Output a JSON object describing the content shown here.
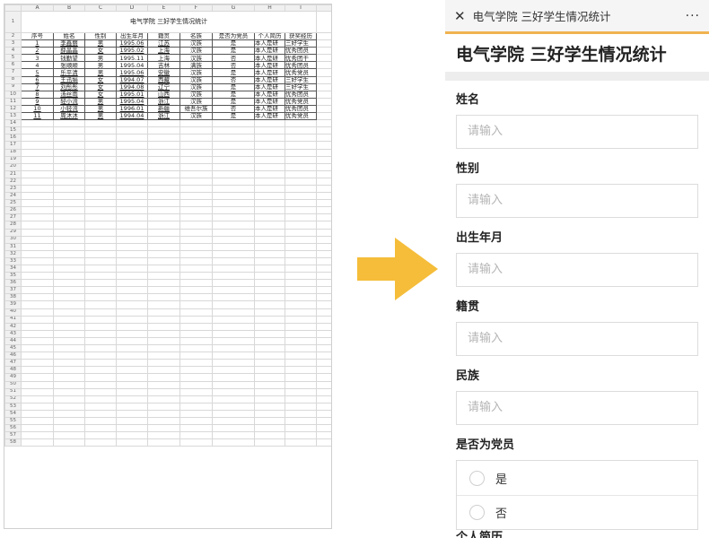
{
  "spreadsheet": {
    "col_headers": [
      "A",
      "B",
      "C",
      "D",
      "E",
      "F",
      "G",
      "H",
      "I"
    ],
    "title": "电气学院 三好学生情况统计",
    "header_row": [
      "序号",
      "姓名",
      "性别",
      "出生年月",
      "籍贯",
      "名族",
      "是否为党员",
      "个人简历",
      "获奖经历"
    ],
    "rows": [
      [
        "1",
        "李鑫丽",
        "男",
        "1995.06",
        "江苏",
        "汉族",
        "是",
        "本人是研",
        "三好学生"
      ],
      [
        "2",
        "薛晶晶",
        "女",
        "1995.02",
        "上海",
        "汉族",
        "是",
        "本人是研",
        "优秀团员"
      ],
      [
        "3",
        "钱勤望",
        "男",
        "1995.11",
        "上海",
        "汉族",
        "否",
        "本人是研",
        "优秀团干"
      ],
      [
        "4",
        "张顺顺",
        "男",
        "1995.04",
        "吉林",
        "满族",
        "否",
        "本人是研",
        "优秀团员"
      ],
      [
        "5",
        "乐平清",
        "男",
        "1995.06",
        "安徽",
        "汉族",
        "是",
        "本人是研",
        "优秀党员"
      ],
      [
        "6",
        "王迅娟",
        "女",
        "1994.07",
        "西藏",
        "汉族",
        "否",
        "本人是研",
        "三好学生"
      ],
      [
        "7",
        "刘彤彤",
        "女",
        "1994.08",
        "辽宁",
        "汉族",
        "是",
        "本人是研",
        "三好学生"
      ],
      [
        "8",
        "汤丝雨",
        "女",
        "1995.01",
        "山西",
        "汉族",
        "是",
        "本人是研",
        "优秀团员"
      ],
      [
        "9",
        "轻小流",
        "男",
        "1995.04",
        "浙江",
        "汉族",
        "是",
        "本人是研",
        "优秀党员"
      ],
      [
        "10",
        "小轻流",
        "男",
        "1996.01",
        "新疆",
        "维吾尔族",
        "否",
        "本人是研",
        "优秀团员"
      ],
      [
        "11",
        "周沐沐",
        "男",
        "1994.04",
        "浙江",
        "汉族",
        "是",
        "本人是研",
        "优秀党员"
      ]
    ],
    "empty_row_count": 45,
    "row_numbers": [
      "1",
      "2",
      "3",
      "4",
      "5",
      "6",
      "7",
      "8",
      "9",
      "10",
      "11",
      "12",
      "13",
      "14",
      "15",
      "16",
      "17",
      "18",
      "19",
      "20",
      "21",
      "22",
      "23",
      "24",
      "25",
      "26",
      "27",
      "28",
      "29",
      "30",
      "31",
      "32",
      "33",
      "34",
      "35",
      "36",
      "37",
      "38",
      "39",
      "40",
      "41",
      "42",
      "43",
      "44",
      "45",
      "46",
      "47",
      "48",
      "49",
      "50",
      "51",
      "52",
      "53",
      "54",
      "55",
      "56",
      "57",
      "58"
    ]
  },
  "arrow": {
    "color": "#f5bd3a"
  },
  "form": {
    "topbar": {
      "close_icon": "✕",
      "title": "电气学院 三好学生情况统计",
      "more_icon": "···"
    },
    "title": "电气学院 三好学生情况统计",
    "fields": [
      {
        "label": "姓名",
        "placeholder": "请输入"
      },
      {
        "label": "性别",
        "placeholder": "请输入"
      },
      {
        "label": "出生年月",
        "placeholder": "请输入"
      },
      {
        "label": "籍贯",
        "placeholder": "请输入"
      },
      {
        "label": "民族",
        "placeholder": "请输入"
      }
    ],
    "party_member": {
      "label": "是否为党员",
      "options": [
        "是",
        "否"
      ]
    },
    "next_label": "个人简历"
  }
}
